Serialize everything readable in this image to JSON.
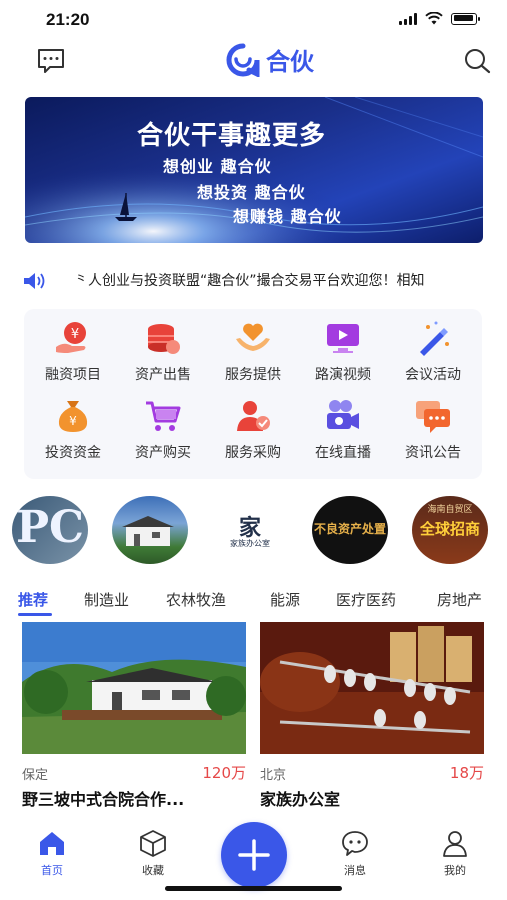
{
  "status": {
    "time": "21:20"
  },
  "header": {
    "logo_text": "合伙"
  },
  "banner": {
    "title": "合伙干事趣更多",
    "lines": [
      "想创业  趣合伙",
      "想投资  趣合伙",
      "想赚钱  趣合伙"
    ]
  },
  "ticker": {
    "text": "⺀人创业与投资联盟“趣合伙”撮合交易平台欢迎您！相知"
  },
  "categories": [
    {
      "label": "融资项目",
      "icon": "financing-icon",
      "color": "#e8433a"
    },
    {
      "label": "资产出售",
      "icon": "coins-icon",
      "color": "#e8433a"
    },
    {
      "label": "服务提供",
      "icon": "heart-hand-icon",
      "color": "#f2932e"
    },
    {
      "label": "路演视频",
      "icon": "video-icon",
      "color": "#a33be0"
    },
    {
      "label": "会议活动",
      "icon": "magic-wand-icon",
      "color": "#3a57e8"
    },
    {
      "label": "投资资金",
      "icon": "money-bag-icon",
      "color": "#f2932e"
    },
    {
      "label": "资产购买",
      "icon": "cart-icon",
      "color": "#a33be0"
    },
    {
      "label": "服务采购",
      "icon": "user-service-icon",
      "color": "#e8433a"
    },
    {
      "label": "在线直播",
      "icon": "camera-icon",
      "color": "#5a4fe0"
    },
    {
      "label": "资讯公告",
      "icon": "chat-icon",
      "color": "#f2662e"
    }
  ],
  "brands": [
    {
      "text": "PC"
    },
    {
      "text": ""
    },
    {
      "text": "家",
      "subtext": "家族办公室"
    },
    {
      "text": "不良资产处置"
    },
    {
      "text": "全球招商",
      "subtext": "海南自贸区"
    }
  ],
  "tabs": [
    "推荐",
    "制造业",
    "农林牧渔",
    "能源",
    "医疗医药",
    "房地产"
  ],
  "cards": [
    {
      "location": "保定",
      "price": "120万",
      "title": "野三坡中式合院合作..."
    },
    {
      "location": "北京",
      "price": "18万",
      "title": "家族办公室"
    }
  ],
  "nav": {
    "home": "首页",
    "favorites": "收藏",
    "messages": "消息",
    "mine": "我的"
  }
}
